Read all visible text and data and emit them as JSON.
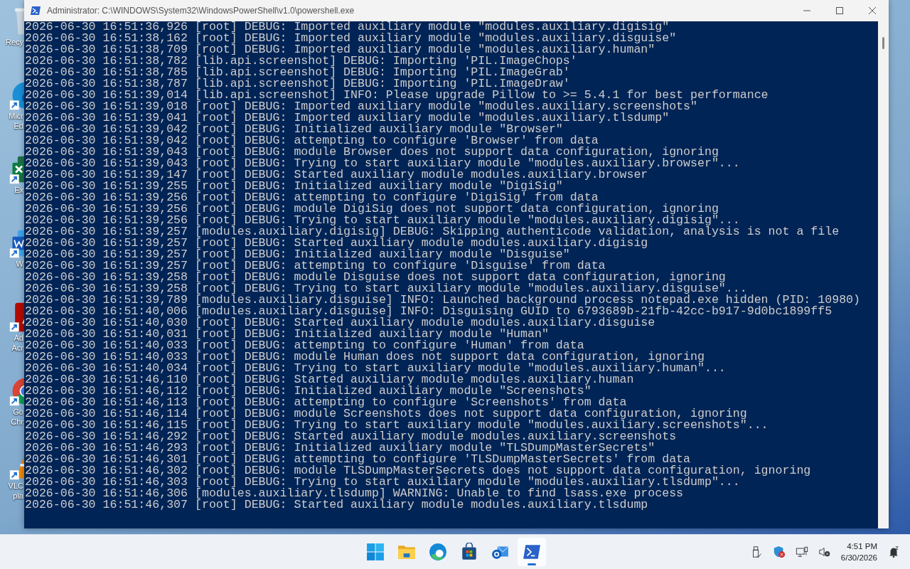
{
  "desktop_icons": [
    {
      "kind": "recycle",
      "label_lines": [
        "Recy"
      ]
    },
    {
      "kind": "edge",
      "label_lines": [
        "Micr",
        "Ed"
      ]
    },
    {
      "kind": "excel",
      "label_lines": [
        "Ex"
      ]
    },
    {
      "kind": "word",
      "label_lines": [
        "W"
      ]
    },
    {
      "kind": "acrobat",
      "label_lines": [
        "Ad",
        "Acr"
      ]
    },
    {
      "kind": "chrome",
      "label_lines": [
        "Go",
        "Chr"
      ]
    },
    {
      "kind": "vlc",
      "label_lines": [
        "VLC",
        "pla"
      ]
    }
  ],
  "window": {
    "title": "Administrator: C:\\WINDOWS\\System32\\WindowsPowerShell\\v1.0\\powershell.exe"
  },
  "console_lines": [
    "2026-06-30 16:51:36,926 [root] DEBUG: Imported auxiliary module \"modules.auxiliary.digisig\"",
    "2026-06-30 16:51:38,162 [root] DEBUG: Imported auxiliary module \"modules.auxiliary.disguise\"",
    "2026-06-30 16:51:38,709 [root] DEBUG: Imported auxiliary module \"modules.auxiliary.human\"",
    "2026-06-30 16:51:38,782 [lib.api.screenshot] DEBUG: Importing 'PIL.ImageChops'",
    "2026-06-30 16:51:38,785 [lib.api.screenshot] DEBUG: Importing 'PIL.ImageGrab'",
    "2026-06-30 16:51:38,787 [lib.api.screenshot] DEBUG: Importing 'PIL.ImageDraw'",
    "2026-06-30 16:51:39,014 [lib.api.screenshot] INFO: Please upgrade Pillow to >= 5.4.1 for best performance",
    "2026-06-30 16:51:39,018 [root] DEBUG: Imported auxiliary module \"modules.auxiliary.screenshots\"",
    "2026-06-30 16:51:39,041 [root] DEBUG: Imported auxiliary module \"modules.auxiliary.tlsdump\"",
    "2026-06-30 16:51:39,042 [root] DEBUG: Initialized auxiliary module \"Browser\"",
    "2026-06-30 16:51:39,042 [root] DEBUG: attempting to configure 'Browser' from data",
    "2026-06-30 16:51:39,043 [root] DEBUG: module Browser does not support data configuration, ignoring",
    "2026-06-30 16:51:39,043 [root] DEBUG: Trying to start auxiliary module \"modules.auxiliary.browser\"...",
    "2026-06-30 16:51:39,147 [root] DEBUG: Started auxiliary module modules.auxiliary.browser",
    "2026-06-30 16:51:39,255 [root] DEBUG: Initialized auxiliary module \"DigiSig\"",
    "2026-06-30 16:51:39,256 [root] DEBUG: attempting to configure 'DigiSig' from data",
    "2026-06-30 16:51:39,256 [root] DEBUG: module DigiSig does not support data configuration, ignoring",
    "2026-06-30 16:51:39,256 [root] DEBUG: Trying to start auxiliary module \"modules.auxiliary.digisig\"...",
    "2026-06-30 16:51:39,257 [modules.auxiliary.digisig] DEBUG: Skipping authenticode validation, analysis is not a file",
    "2026-06-30 16:51:39,257 [root] DEBUG: Started auxiliary module modules.auxiliary.digisig",
    "2026-06-30 16:51:39,257 [root] DEBUG: Initialized auxiliary module \"Disguise\"",
    "2026-06-30 16:51:39,257 [root] DEBUG: attempting to configure 'Disguise' from data",
    "2026-06-30 16:51:39,258 [root] DEBUG: module Disguise does not support data configuration, ignoring",
    "2026-06-30 16:51:39,258 [root] DEBUG: Trying to start auxiliary module \"modules.auxiliary.disguise\"...",
    "2026-06-30 16:51:39,789 [modules.auxiliary.disguise] INFO: Launched background process notepad.exe hidden (PID: 10980)",
    "2026-06-30 16:51:40,006 [modules.auxiliary.disguise] INFO: Disguising GUID to 6793689b-21fb-42cc-b917-9d0bc1899ff5",
    "2026-06-30 16:51:40,030 [root] DEBUG: Started auxiliary module modules.auxiliary.disguise",
    "2026-06-30 16:51:40,031 [root] DEBUG: Initialized auxiliary module \"Human\"",
    "2026-06-30 16:51:40,033 [root] DEBUG: attempting to configure 'Human' from data",
    "2026-06-30 16:51:40,033 [root] DEBUG: module Human does not support data configuration, ignoring",
    "2026-06-30 16:51:40,034 [root] DEBUG: Trying to start auxiliary module \"modules.auxiliary.human\"...",
    "2026-06-30 16:51:46,110 [root] DEBUG: Started auxiliary module modules.auxiliary.human",
    "2026-06-30 16:51:46,112 [root] DEBUG: Initialized auxiliary module \"Screenshots\"",
    "2026-06-30 16:51:46,113 [root] DEBUG: attempting to configure 'Screenshots' from data",
    "2026-06-30 16:51:46,114 [root] DEBUG: module Screenshots does not support data configuration, ignoring",
    "2026-06-30 16:51:46,115 [root] DEBUG: Trying to start auxiliary module \"modules.auxiliary.screenshots\"...",
    "2026-06-30 16:51:46,292 [root] DEBUG: Started auxiliary module modules.auxiliary.screenshots",
    "2026-06-30 16:51:46,293 [root] DEBUG: Initialized auxiliary module \"TLSDumpMasterSecrets\"",
    "2026-06-30 16:51:46,301 [root] DEBUG: attempting to configure 'TLSDumpMasterSecrets' from data",
    "2026-06-30 16:51:46,302 [root] DEBUG: module TLSDumpMasterSecrets does not support data configuration, ignoring",
    "2026-06-30 16:51:46,303 [root] DEBUG: Trying to start auxiliary module \"modules.auxiliary.tlsdump\"...",
    "2026-06-30 16:51:46,306 [modules.auxiliary.tlsdump] WARNING: Unable to find lsass.exe process",
    "2026-06-30 16:51:46,307 [root] DEBUG: Started auxiliary module modules.auxiliary.tlsdump"
  ],
  "taskbar": {
    "apps": [
      {
        "kind": "start",
        "selected": false
      },
      {
        "kind": "explorer",
        "selected": false
      },
      {
        "kind": "edge",
        "selected": false
      },
      {
        "kind": "store",
        "selected": false
      },
      {
        "kind": "outlook",
        "selected": false
      },
      {
        "kind": "powershell",
        "selected": true
      }
    ],
    "tray": [
      {
        "kind": "usb"
      },
      {
        "kind": "shield"
      },
      {
        "kind": "network"
      },
      {
        "kind": "speaker"
      }
    ],
    "time": "4:51 PM",
    "date": "6/30/2026"
  }
}
